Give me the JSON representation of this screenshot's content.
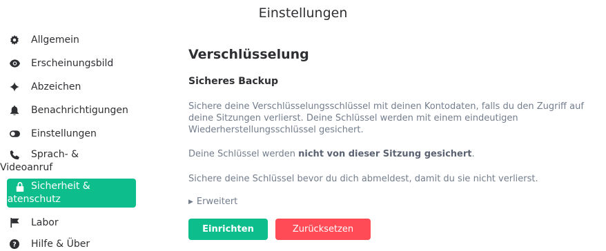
{
  "header": {
    "title": "Einstellungen"
  },
  "sidebar": {
    "items": [
      {
        "label": "Allgemein",
        "icon": "gear-icon"
      },
      {
        "label": "Erscheinungsbild",
        "icon": "eye-icon"
      },
      {
        "label": "Abzeichen",
        "icon": "sparkle-icon"
      },
      {
        "label": "Benachrichtigungen",
        "icon": "bell-icon"
      },
      {
        "label": "Einstellungen",
        "icon": "toggle-icon"
      },
      {
        "label": "Sprach- & Videoanruf",
        "icon": "phone-icon"
      },
      {
        "label": "Sicherheit & Datenschutz",
        "icon": "lock-icon",
        "active": true
      },
      {
        "label": "Labor",
        "icon": "flag-icon"
      },
      {
        "label": "Hilfe & Über",
        "icon": "help-icon"
      }
    ]
  },
  "main": {
    "section_title": "Verschlüsselung",
    "subsection_title": "Sicheres Backup",
    "description": "Sichere deine Verschlüsselungsschlüssel mit deinen Kontodaten, falls du den Zugriff auf deine Sitzungen verlierst. Deine Schlüssel werden mit einem eindeutigen Wiederherstellungsschlüssel gesichert.",
    "status_prefix": "Deine Schlüssel werden ",
    "status_bold": "nicht von dieser Sitzung gesichert",
    "status_suffix": ".",
    "hint": "Sichere deine Schlüssel bevor du dich abmeldest, damit du sie nicht verlierst.",
    "advanced_label": "Erweitert",
    "setup_button": "Einrichten",
    "reset_button": "Zurücksetzen"
  },
  "colors": {
    "accent": "#0dbd8b",
    "danger": "#ff4b55",
    "text": "#2e2f32",
    "muted": "#737d8c"
  }
}
